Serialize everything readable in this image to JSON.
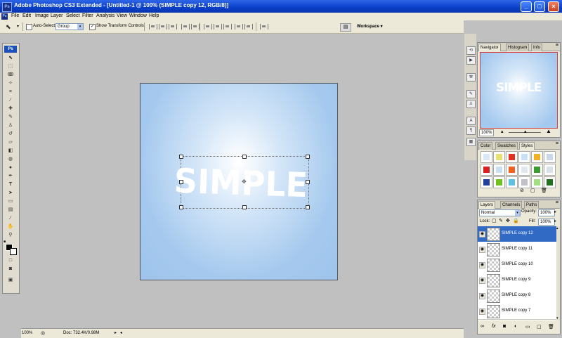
{
  "window": {
    "title": "Adobe Photoshop CS3 Extended - [Untitled-1 @ 100% (SIMPLE copy 12, RGB/8)]",
    "logo": "Ps",
    "minimize": "_",
    "maximize": "□",
    "close": "×"
  },
  "menu": [
    "File",
    "Edit",
    "Image",
    "Layer",
    "Select",
    "Filter",
    "Analysis",
    "View",
    "Window",
    "Help"
  ],
  "options": {
    "auto_select_label": "Auto-Select:",
    "auto_select_value": "Group",
    "show_transform_label": "Show Transform Controls",
    "workspace_label": "Workspace ▾"
  },
  "tools": {
    "logo": "Ps"
  },
  "canvas": {
    "text": "SIMPLE",
    "background_color": "#a5c9ee"
  },
  "status": {
    "zoom": "100%",
    "doc": "Doc: 732.4K/0.98M"
  },
  "navigator": {
    "tabs": [
      "Navigator",
      "Histogram",
      "Info"
    ],
    "zoom": "100%",
    "preview_text": "SIMPLE"
  },
  "styles_panel": {
    "tabs": [
      "Color",
      "Swatches",
      "Styles"
    ],
    "swatch_colors": [
      "#d9e8f8",
      "#e8e070",
      "#e03020",
      "#c8e0f8",
      "#f0b020",
      "#c8d8e8",
      "#d82020",
      "#c8e0f0",
      "#f06020",
      "#e0e8f0",
      "#3c9c30",
      "#d8e0e8",
      "#2040a0",
      "#70c020",
      "#60c0e0",
      "#c0c0c8",
      "#a0e080",
      "#207020"
    ]
  },
  "layers_panel": {
    "tabs": [
      "Layers",
      "Channels",
      "Paths"
    ],
    "blend_mode": "Normal",
    "opacity_label": "Opacity:",
    "opacity_value": "100%",
    "lock_label": "Lock:",
    "fill_label": "Fill:",
    "fill_value": "100%",
    "layers": [
      {
        "name": "SIMPLE copy 12",
        "selected": true
      },
      {
        "name": "SIMPLE copy 11",
        "selected": false
      },
      {
        "name": "SIMPLE copy 10",
        "selected": false
      },
      {
        "name": "SIMPLE copy 9",
        "selected": false
      },
      {
        "name": "SIMPLE copy 8",
        "selected": false
      },
      {
        "name": "SIMPLE copy 7",
        "selected": false
      }
    ]
  }
}
